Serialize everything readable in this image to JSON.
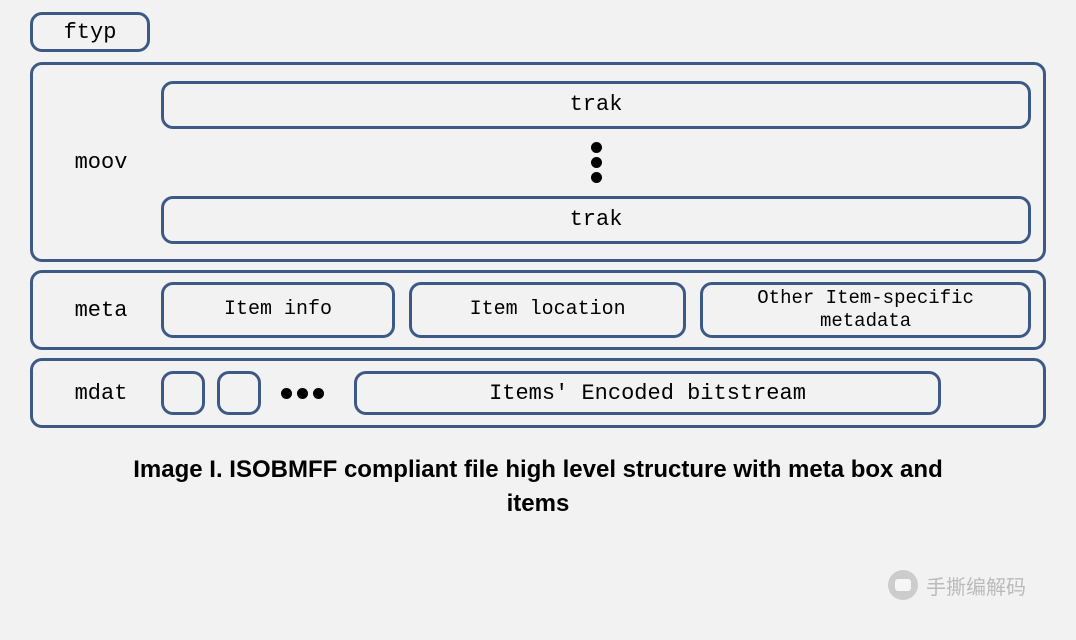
{
  "boxes": {
    "ftyp": "ftyp",
    "moov": {
      "label": "moov",
      "trak1": "trak",
      "trak2": "trak"
    },
    "meta": {
      "label": "meta",
      "item_info": "Item info",
      "item_location": "Item location",
      "item_other": "Other Item-specific metadata"
    },
    "mdat": {
      "label": "mdat",
      "bitstream": "Items' Encoded bitstream"
    }
  },
  "caption": "Image I. ISOBMFF compliant file high level structure with meta box and items",
  "watermark": "手撕编解码"
}
